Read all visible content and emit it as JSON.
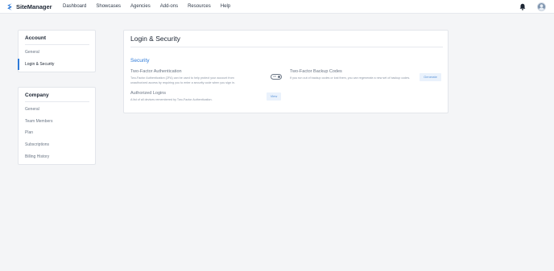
{
  "app": {
    "brand": "SiteManager",
    "brand_color": "#2e7ad8"
  },
  "nav": {
    "items": [
      "Dashboard",
      "Showcases",
      "Agencies",
      "Add-ons",
      "Resources",
      "Help"
    ]
  },
  "header_icons": {
    "notifications": "bell-icon",
    "profile": "avatar-icon"
  },
  "sidebar": {
    "account": {
      "title": "Account",
      "items": [
        "General",
        "Login & Security"
      ],
      "active": "Login & Security"
    },
    "company": {
      "title": "Company",
      "items": [
        "General",
        "Team Members",
        "Plan",
        "Subscriptions",
        "Billing History"
      ]
    }
  },
  "main": {
    "title": "Login & Security",
    "section": "Security",
    "two_factor": {
      "title": "Two-Factor Authentication",
      "description": "Two-Factor Authentication (2FA) can be used to help protect your account from unauthorized access by requiring you to enter a security code when you sign in.",
      "toggle_label": "Off",
      "enabled": false
    },
    "backup_codes": {
      "title": "Two-Factor Backup Codes",
      "description": "If you run out of backup codes or lost them, you can regenerate a new set of backup codes.",
      "button": "Generate"
    },
    "authorized_logins": {
      "title": "Authorized Logins",
      "description": "A list of all devices remembered by Two-Factor Authentication.",
      "button": "View"
    }
  }
}
